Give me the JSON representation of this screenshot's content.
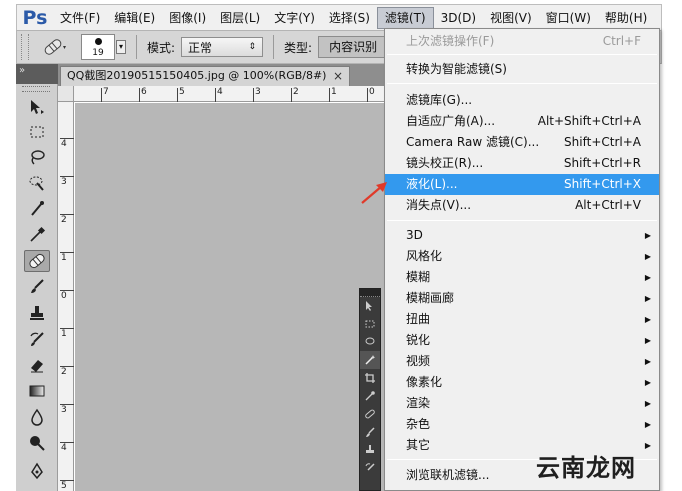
{
  "app": {
    "logo": "Ps"
  },
  "menubar": {
    "items": [
      "文件(F)",
      "编辑(E)",
      "图像(I)",
      "图层(L)",
      "文字(Y)",
      "选择(S)",
      "滤镜(T)",
      "3D(D)",
      "视图(V)",
      "窗口(W)",
      "帮助(H)"
    ],
    "active": "滤镜(T)"
  },
  "options": {
    "brush_size": "19",
    "mode_label": "模式:",
    "mode_value": "正常",
    "type_label": "类型:",
    "type_value": "内容识别"
  },
  "document": {
    "tab_title": "QQ截图20190515150405.jpg @ 100%(RGB/8#)",
    "close": "×"
  },
  "rulers": {
    "top": [
      "7",
      "6",
      "5",
      "4",
      "3",
      "2",
      "1",
      "0"
    ],
    "left": [
      "4",
      "3",
      "2",
      "1",
      "0",
      "1",
      "2",
      "3",
      "4",
      "5"
    ]
  },
  "filter_menu": {
    "last_filter": {
      "label": "上次滤镜操作(F)",
      "shortcut": "Ctrl+F"
    },
    "convert_smart": {
      "label": "转换为智能滤镜(S)"
    },
    "gallery": {
      "label": "滤镜库(G)..."
    },
    "adaptive_wide": {
      "label": "自适应广角(A)...",
      "shortcut": "Alt+Shift+Ctrl+A"
    },
    "camera_raw": {
      "label": "Camera Raw 滤镜(C)...",
      "shortcut": "Shift+Ctrl+A"
    },
    "lens_correction": {
      "label": "镜头校正(R)...",
      "shortcut": "Shift+Ctrl+R"
    },
    "liquify": {
      "label": "液化(L)...",
      "shortcut": "Shift+Ctrl+X"
    },
    "vanishing_point": {
      "label": "消失点(V)...",
      "shortcut": "Alt+Ctrl+V"
    },
    "submenus": [
      "3D",
      "风格化",
      "模糊",
      "模糊画廊",
      "扭曲",
      "锐化",
      "视频",
      "像素化",
      "渲染",
      "杂色",
      "其它"
    ],
    "browse_online": {
      "label": "浏览联机滤镜..."
    }
  },
  "colors": {
    "highlight": "#3399ee",
    "annotation_arrow": "#e03a2a",
    "logo": "#2b5aa8"
  },
  "watermark": {
    "text": "云南龙网"
  },
  "icons": [
    "move-icon",
    "marquee-icon",
    "lasso-icon",
    "quick-select-icon",
    "crop-icon",
    "eyedropper-icon",
    "healing-brush-icon",
    "brush-icon",
    "clone-stamp-icon",
    "history-brush-icon",
    "eraser-icon",
    "gradient-icon",
    "blur-icon",
    "dodge-icon",
    "pen-icon"
  ]
}
